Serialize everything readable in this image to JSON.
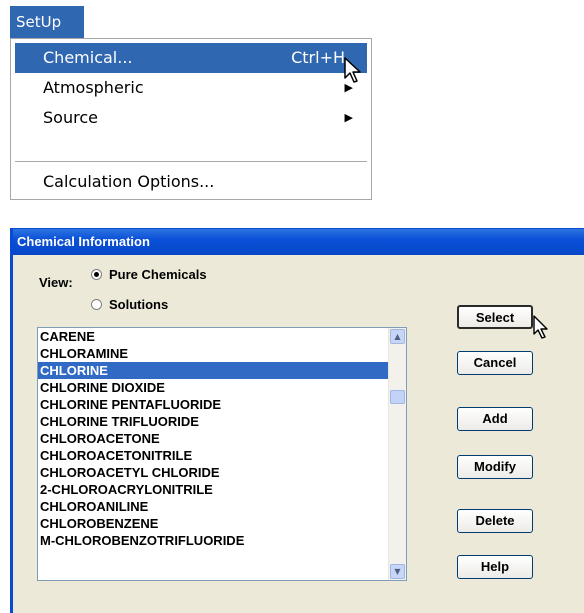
{
  "menu": {
    "title": "SetUp",
    "items": [
      {
        "label": "Chemical...",
        "shortcut": "Ctrl+H",
        "highlighted": true
      },
      {
        "label": "Atmospheric",
        "submenu": true
      },
      {
        "label": "Source",
        "submenu": true
      },
      {
        "label": "Calculation Options..."
      }
    ]
  },
  "dialog": {
    "title": "Chemical Information",
    "view_label": "View:",
    "radio_options": [
      {
        "label": "Pure Chemicals",
        "checked": true
      },
      {
        "label": "Solutions",
        "checked": false
      }
    ],
    "list_items": [
      "CARENE",
      "CHLORAMINE",
      "CHLORINE",
      "CHLORINE DIOXIDE",
      "CHLORINE PENTAFLUORIDE",
      "CHLORINE TRIFLUORIDE",
      "CHLOROACETONE",
      "CHLOROACETONITRILE",
      "CHLOROACETYL CHLORIDE",
      "2-CHLOROACRYLONITRILE",
      "CHLOROANILINE",
      "CHLOROBENZENE",
      "M-CHLOROBENZOTRIFLUORIDE"
    ],
    "selected_item": "CHLORINE",
    "buttons": {
      "select": "Select",
      "cancel": "Cancel",
      "add": "Add",
      "modify": "Modify",
      "delete": "Delete",
      "help": "Help"
    }
  },
  "colors": {
    "menu_highlight": "#2f67b0",
    "list_selection": "#316ac5",
    "titlebar": "#0a50d8",
    "dialog_bg": "#ece9d8"
  },
  "icons": [
    "arrow-cursor-icon",
    "submenu-arrow-icon",
    "scroll-up-icon",
    "scroll-down-icon",
    "radio-icon"
  ]
}
